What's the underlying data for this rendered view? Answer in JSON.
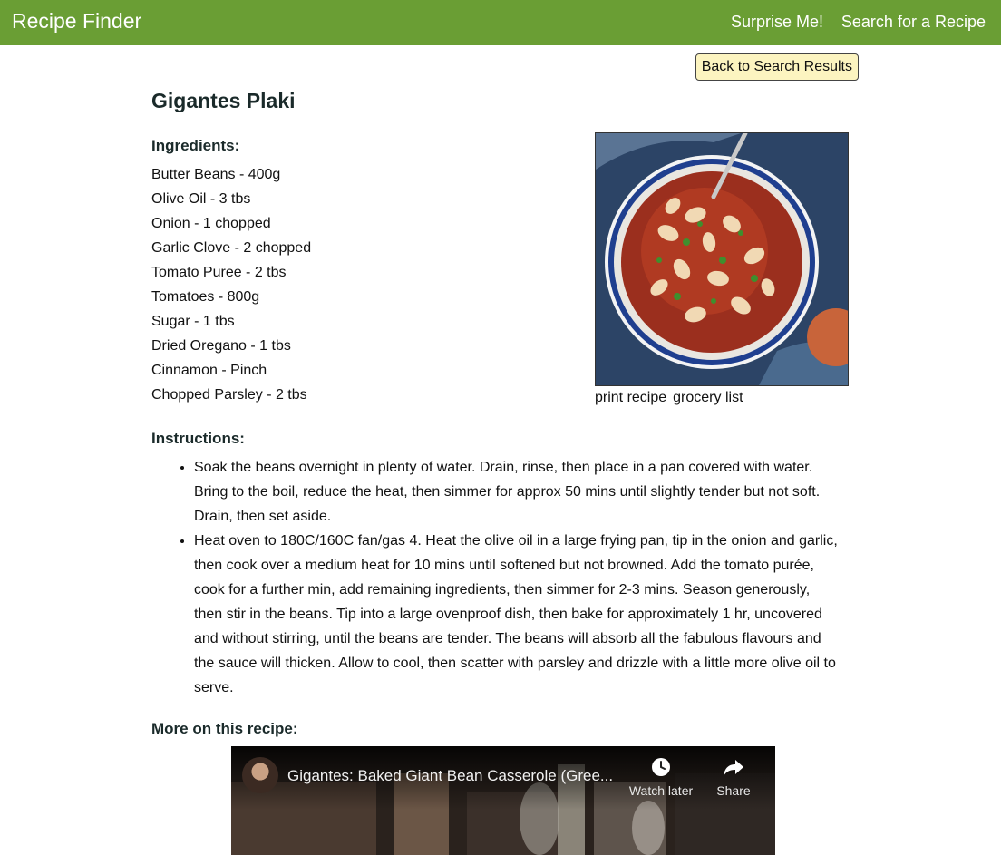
{
  "navbar": {
    "brand": "Recipe Finder",
    "links": [
      "Surprise Me!",
      "Search for a Recipe"
    ],
    "background_color": "#6a9e34"
  },
  "back_button": {
    "label": "Back to Search Results",
    "background_color": "#fcf4c0"
  },
  "recipe": {
    "title": "Gigantes Plaki",
    "ingredients_heading": "Ingredients:",
    "ingredients": [
      "Butter Beans - 400g",
      "Olive Oil - 3 tbs",
      "Onion - 1 chopped",
      "Garlic Clove - 2 chopped",
      "Tomato Puree - 2 tbs",
      "Tomatoes - 800g",
      "Sugar - 1 tbs",
      "Dried Oregano - 1 tbs",
      "Cinnamon - Pinch",
      "Chopped Parsley - 2 tbs"
    ],
    "image_links": [
      "print recipe",
      "grocery list"
    ],
    "instructions_heading": "Instructions:",
    "instructions": [
      "Soak the beans overnight in plenty of water. Drain, rinse, then place in a pan covered with water. Bring to the boil, reduce the heat, then simmer for approx 50 mins until slightly tender but not soft. Drain, then set aside.",
      "Heat oven to 180C/160C fan/gas 4. Heat the olive oil in a large frying pan, tip in the onion and garlic, then cook over a medium heat for 10 mins until softened but not browned. Add the tomato purée, cook for a further min, add remaining ingredients, then simmer for 2-3 mins. Season generously, then stir in the beans. Tip into a large ovenproof dish, then bake for approximately 1 hr, uncovered and without stirring, until the beans are tender. The beans will absorb all the fabulous flavours and the sauce will thicken. Allow to cool, then scatter with parsley and drizzle with a little more olive oil to serve."
    ],
    "more_heading": "More on this recipe:"
  },
  "video": {
    "title": "Gigantes: Baked Giant Bean Casserole (Gree...",
    "watch_later_label": "Watch later",
    "share_label": "Share",
    "watch_later_icon": "clock-icon",
    "share_icon": "share-arrow-icon"
  }
}
